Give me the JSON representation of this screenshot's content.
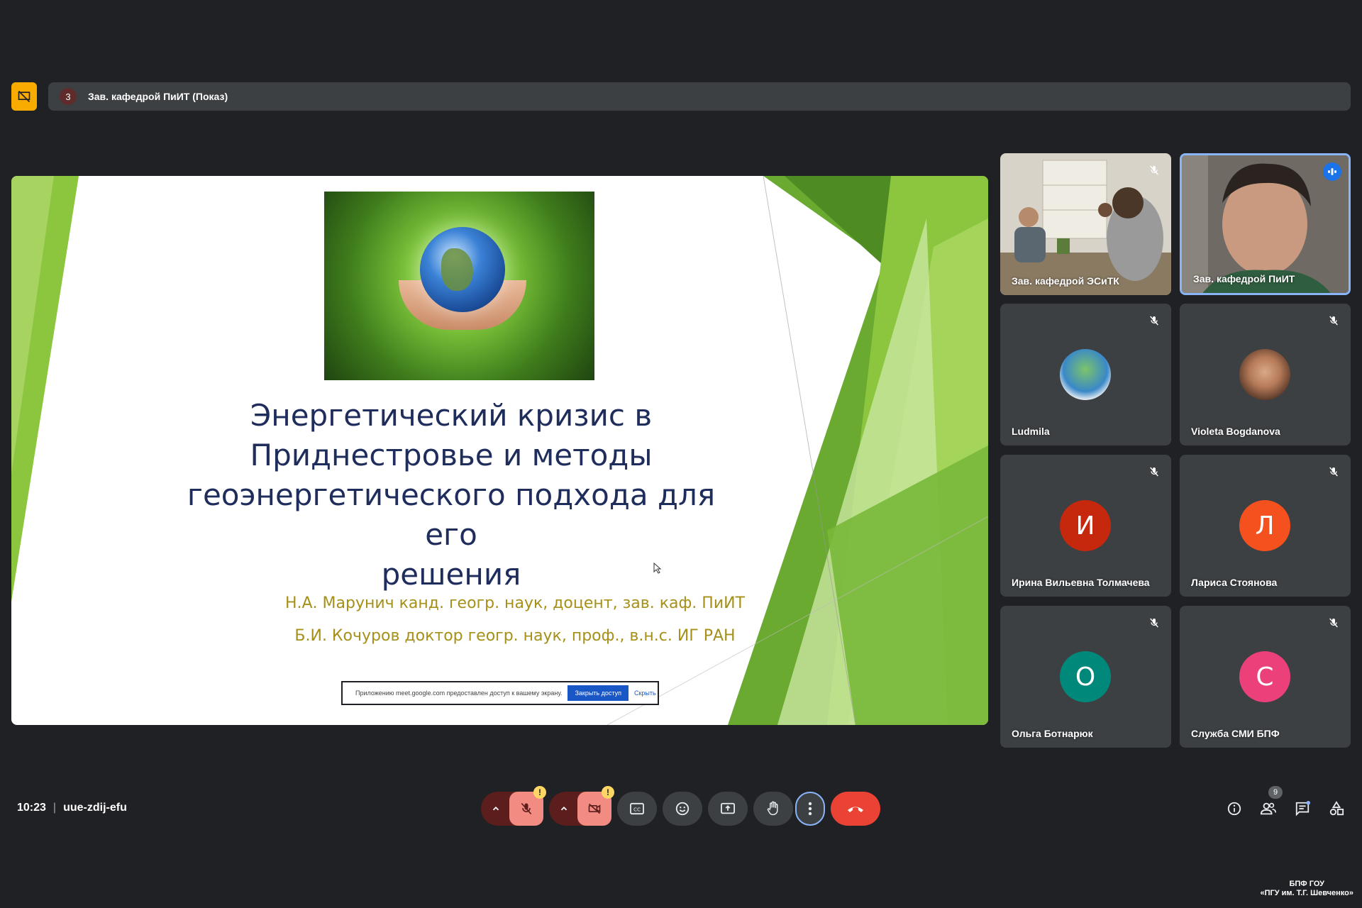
{
  "top_bar": {
    "count": "3",
    "title": "Зав. кафедрой ПиИТ (Показ)"
  },
  "slide": {
    "title_lines": [
      "Энергетический кризис в",
      "Приднестровье и методы",
      "геоэнергетического подхода для его",
      "решения"
    ],
    "authors": [
      "Н.А. Марунич канд. геогр. наук, доцент, зав. каф. ПиИТ",
      "Б.И. Кочуров доктор геогр. наук, проф., в.н.с. ИГ РАН"
    ],
    "share_notice": {
      "text": "Приложению meet.google.com предоставлен доступ к вашему экрану.",
      "stop_label": "Закрыть доступ",
      "hide_label": "Скрыть"
    }
  },
  "participants": [
    {
      "name": "Зав. кафедрой ЭСиТК",
      "muted": true,
      "video": true
    },
    {
      "name": "Зав. кафедрой ПиИТ",
      "muted": false,
      "video": true,
      "active": true
    },
    {
      "name": "Ludmila",
      "muted": true,
      "avatar_type": "image"
    },
    {
      "name": "Violeta Bogdanova",
      "muted": true,
      "avatar_type": "photo"
    },
    {
      "name": "Ирина Вильевна Толмачева",
      "muted": true,
      "initial": "И",
      "color": "#c5280c"
    },
    {
      "name": "Лариса Стоянова",
      "muted": true,
      "initial": "Л",
      "color": "#f4511e"
    },
    {
      "name": "Ольга Ботнарюк",
      "muted": true,
      "initial": "О",
      "color": "#00897b"
    },
    {
      "name": "Служба СМИ БПФ",
      "muted": true,
      "initial": "С",
      "color": "#ec407a"
    }
  ],
  "bottom_bar": {
    "time": "10:23",
    "meeting_code": "uue-zdij-efu",
    "participants_count": "9"
  },
  "watermark": {
    "line1": "БПФ ГОУ",
    "line2": "«ПГУ им. Т.Г. Шевченко»"
  },
  "colors": {
    "background": "#202124",
    "tile": "#3c4043",
    "end_call": "#ea4335",
    "muted_red": "#f28b82",
    "present_badge": "#f9ab00"
  }
}
